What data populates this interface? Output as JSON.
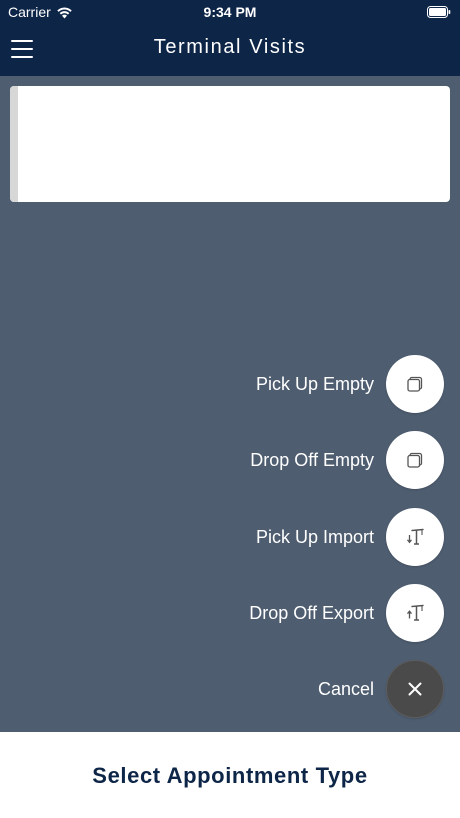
{
  "status_bar": {
    "carrier": "Carrier",
    "time": "9:34 PM",
    "icons": [
      "wifi-icon",
      "battery-icon"
    ]
  },
  "nav": {
    "title": "Terminal Visits",
    "menu_icon": "hamburger-menu-icon"
  },
  "fab_menu": {
    "items": [
      {
        "label": "Pick Up Empty",
        "icon": "container-empty-icon"
      },
      {
        "label": "Drop Off Empty",
        "icon": "container-empty-icon"
      },
      {
        "label": "Pick Up Import",
        "icon": "crane-down-icon"
      },
      {
        "label": "Drop Off Export",
        "icon": "crane-up-icon"
      }
    ],
    "cancel_label": "Cancel",
    "cancel_icon": "close-icon"
  },
  "bottom_sheet": {
    "title": "Select Appointment Type"
  },
  "colors": {
    "navy": "#0d2547",
    "overlay": "#4e5d70",
    "card": "#ffffff",
    "cancel_button": "#4a4a4a"
  }
}
